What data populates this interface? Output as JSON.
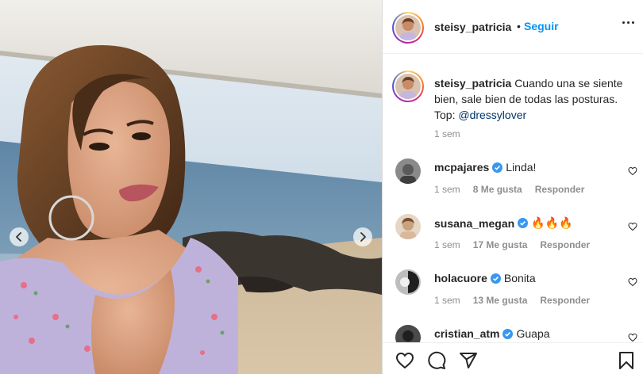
{
  "post": {
    "username": "steisy_patricia",
    "dot": "•",
    "follow_label": "Seguir",
    "caption_text": "Cuando una se siente bien, sale bien de todas las posturas. Top: ",
    "caption_mention": "@dressylover",
    "caption_time": "1 sem"
  },
  "comments": [
    {
      "user": "mcpajares",
      "verified": true,
      "text": "Linda!",
      "time": "1 sem",
      "likes": "8 Me gusta",
      "reply": "Responder",
      "avatar_color": "#5a5a5a"
    },
    {
      "user": "susana_megan",
      "verified": true,
      "text": "🔥🔥🔥",
      "time": "1 sem",
      "likes": "17 Me gusta",
      "reply": "Responder",
      "avatar_color": "#c9a27e"
    },
    {
      "user": "holacuore",
      "verified": true,
      "text": "Bonita",
      "time": "1 sem",
      "likes": "13 Me gusta",
      "reply": "Responder",
      "avatar_color": "#2b2b2b"
    },
    {
      "user": "cristian_atm",
      "verified": true,
      "text": "Guapa",
      "time": "",
      "likes": "",
      "reply": "",
      "avatar_color": "#1f1f1f"
    }
  ],
  "colors": {
    "follow_blue": "#0095f6",
    "verified_blue": "#3897f0",
    "mention_blue": "#00376b",
    "meta_gray": "#8e8e8e"
  },
  "icons": [
    "chevron-left-icon",
    "chevron-right-icon",
    "more-icon",
    "heart-icon",
    "comment-icon",
    "share-icon",
    "bookmark-icon",
    "verified-badge-icon"
  ]
}
